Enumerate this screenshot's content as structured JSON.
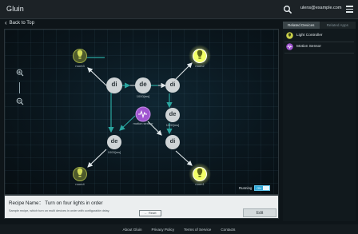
{
  "app": {
    "title": "Gluin"
  },
  "header": {
    "user_email": "ulens@example.com"
  },
  "nav": {
    "back_label": "Back to Top"
  },
  "graph": {
    "nodes": {
      "room3": "room3",
      "room2": "room2",
      "room4": "room4",
      "room1": "room1",
      "de_top": "1000[ms]",
      "de_mid": "1000[ms]",
      "de_left": "1000[ms]",
      "sensor": "motion sensor"
    },
    "glyph_di": "di",
    "glyph_de": "de"
  },
  "recipe": {
    "name": "Recipe Name： Turn on four lights in order",
    "description": "Sample recipe, which turn on multi devices in order with configurable delay.",
    "reset_label": "Reset",
    "edit_label": "Edit"
  },
  "status": {
    "running_label": "Running",
    "toggle_label": "ON"
  },
  "sidebar": {
    "tabs": [
      {
        "label": "Related Devices",
        "active": true
      },
      {
        "label": "Related Apps",
        "active": false
      }
    ],
    "devices": [
      {
        "label": "Light Controller",
        "icon": "light-controller-icon",
        "color": "#c9cf4a"
      },
      {
        "label": "Motion Sensor",
        "icon": "motion-sensor-icon",
        "color": "#a055d0"
      }
    ]
  },
  "footer": {
    "links": [
      "About Gluin",
      "Privacy Policy",
      "Terms of Service",
      "Contacts"
    ]
  },
  "colors": {
    "accent": "#2fa8d8",
    "edge": "#2aa6a0",
    "light": "#d8e84a",
    "sensor": "#9a4fd0"
  }
}
